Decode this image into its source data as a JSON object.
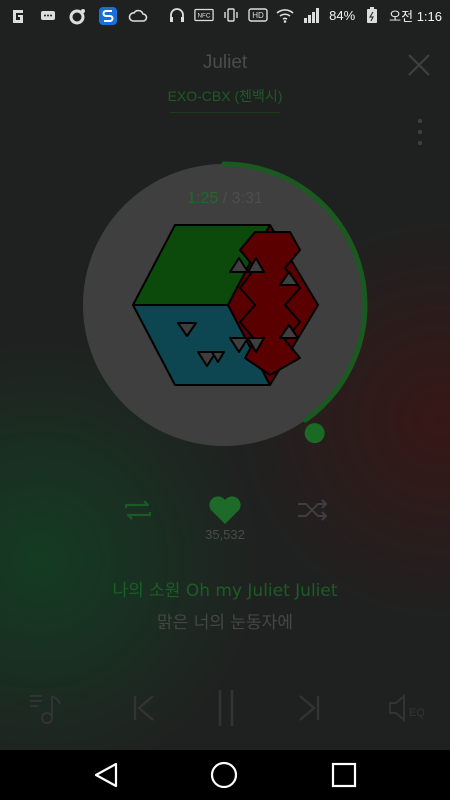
{
  "status_bar": {
    "battery_percent": "84%",
    "time": "오전 1:16",
    "icons_left": [
      "g-app-icon",
      "chat-icon",
      "camera-app-icon",
      "s-app-icon",
      "weather-icon"
    ],
    "icons_right": [
      "headphones-icon",
      "nfc-icon",
      "vibrate-icon",
      "hd-icon",
      "wifi-icon",
      "signal-icon",
      "battery-icon"
    ]
  },
  "player": {
    "title": "Juliet",
    "artist": "EXO-CBX (첸백시)",
    "current_time": "1:25",
    "separator": "/",
    "total_time": "3:31",
    "progress": 0.402,
    "like_count": "35,532",
    "lyrics": {
      "current": "나의 소원 Oh my Juliet Juliet",
      "next": "맑은 너의 눈동자에"
    }
  },
  "colors": {
    "accent_green": "#1f6a2a",
    "cube_green": "#0c4a0c",
    "cube_blue": "#0d4550",
    "cube_red": "#5a0000",
    "disc": "#3f3f3f"
  }
}
